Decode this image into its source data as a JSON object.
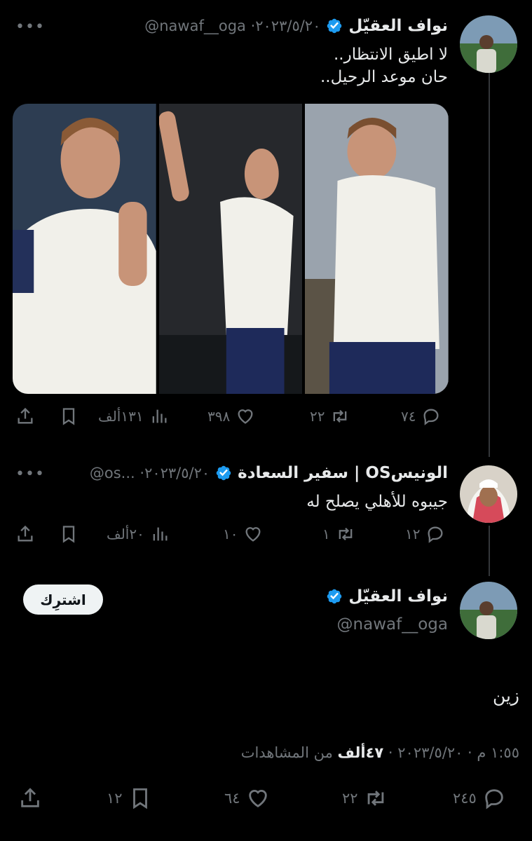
{
  "tweet1": {
    "name": "نواف العقيّل",
    "handle_date": "@nawaf__oga ·٢٠٢٣/٥/٢٠",
    "line1": "لا اطيق الانتظار..",
    "line2": "حان موعد الرحيل..",
    "actions": {
      "replies": "٧٤",
      "retweets": "٢٢",
      "likes": "٣٩٨",
      "views": "١٣١ألف"
    }
  },
  "tweet2": {
    "name": "الونيسOS | سفير السعادة",
    "handle_date": "@os... ·٢٠٢٣/٥/٢٠",
    "text": "جيبوه للأهلي يصلح له",
    "actions": {
      "replies": "١٢",
      "retweets": "١",
      "likes": "١٠",
      "views": "٢٠ألف"
    }
  },
  "tweet3": {
    "name": "نواف العقيّل",
    "handle": "@nawaf__oga",
    "subscribe_label": "اشترِك",
    "text": "زين",
    "time_line": "١:٥٥ م · ٢٠٢٣/٥/٢٠ · ",
    "views_count": "٤٧ألف",
    "views_suffix": " من المشاهدات",
    "actions": {
      "replies": "٢٤٥",
      "retweets": "٢٢",
      "likes": "٦٤",
      "bookmarks": "١٢"
    }
  },
  "more_label": "•••",
  "colors": {
    "verified": "#1d9bf0",
    "background": "#000000",
    "muted": "#71767b",
    "text": "#e7e9ea"
  }
}
